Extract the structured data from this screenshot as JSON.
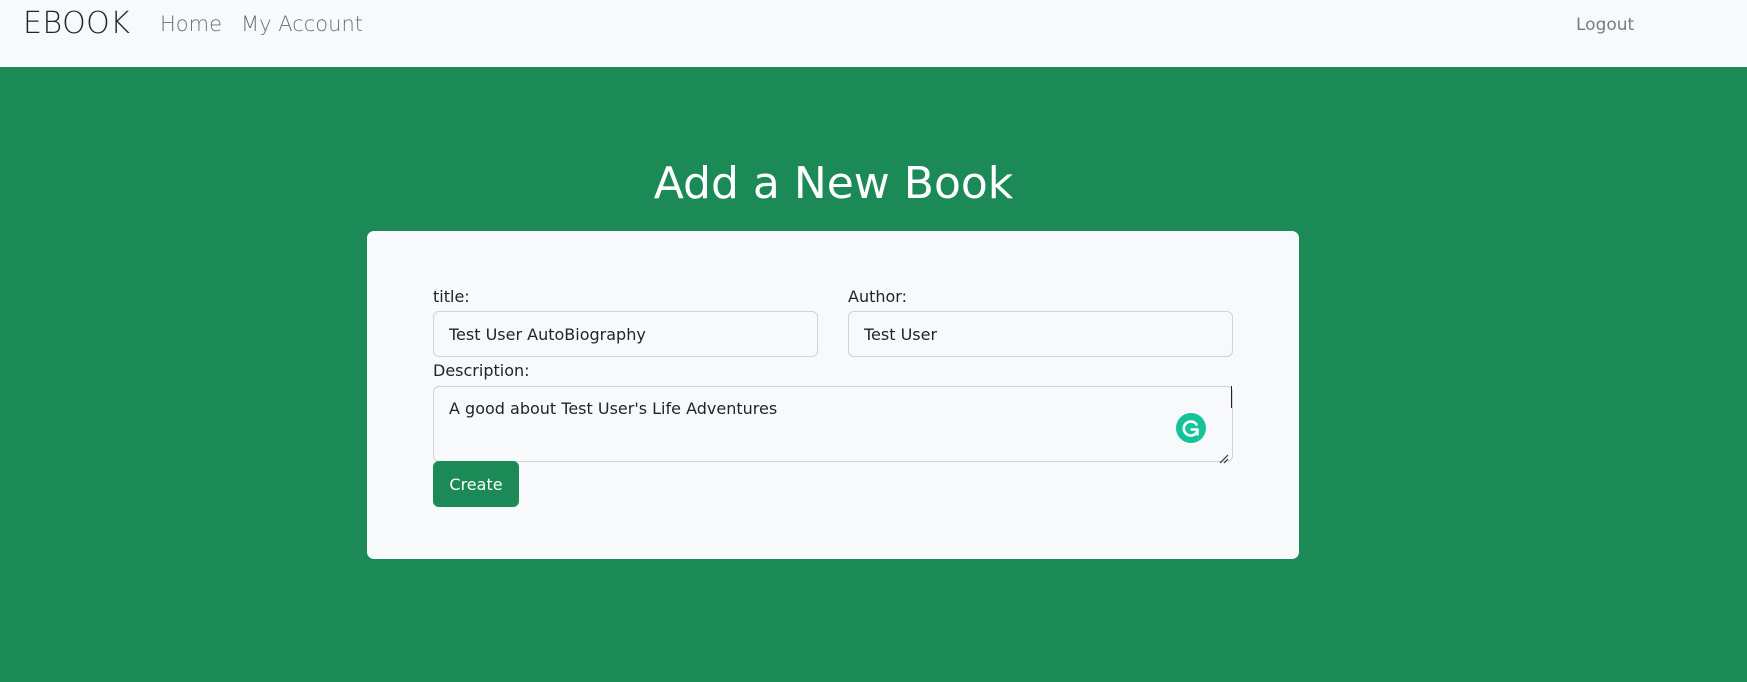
{
  "navbar": {
    "brand": "EBOOK",
    "links": [
      {
        "label": "Home"
      },
      {
        "label": "My Account"
      }
    ],
    "logout_label": "Logout"
  },
  "main": {
    "heading": "Add a New Book"
  },
  "form": {
    "title_label": "title:",
    "title_value": "Test User AutoBiography",
    "author_label": "Author:",
    "author_value": "Test User",
    "description_label": "Description:",
    "description_value": "A good about Test User's Life Adventures",
    "submit_label": "Create"
  },
  "icons": {
    "grammarly": "grammarly-icon",
    "resize": "resize-handle-icon"
  },
  "colors": {
    "background": "#1b8a56",
    "navbar": "#f8f9fa",
    "card": "#f8f9fa",
    "button": "#1b8a56",
    "grammarly": "#15c39a"
  }
}
